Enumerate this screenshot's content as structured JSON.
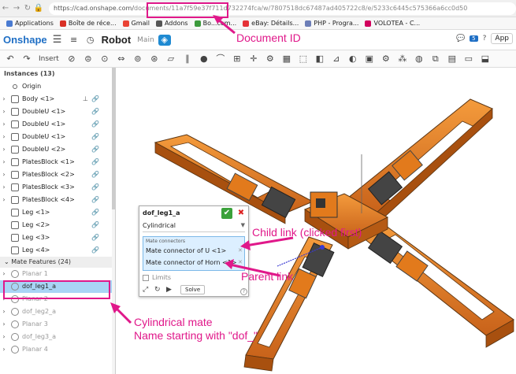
{
  "browser": {
    "url_host": "https://cad.onshape.com/",
    "url_path": "documents/11a7f59e37f711d732274fca/w/7807518dc67487ad405722c8/e/5233c6445c575366a6cc0d50",
    "bookmarks": [
      {
        "label": "Applications",
        "color": "#4a7bd1"
      },
      {
        "label": "Boîte de réce...",
        "color": "#d93025"
      },
      {
        "label": "Gmail",
        "color": "#ea4335"
      },
      {
        "label": "Addons",
        "color": "#555555"
      },
      {
        "label": "Bo...com...",
        "color": "#3c9a3c"
      },
      {
        "label": "eBay: Détails...",
        "color": "#e53238"
      },
      {
        "label": "PHP - Progra...",
        "color": "#6c7eb7"
      },
      {
        "label": "VOLOTEA - C...",
        "color": "#d1005d"
      }
    ]
  },
  "app": {
    "logo": "Onshape",
    "doc_name": "Robot",
    "branch": "Main",
    "notif_count": "5",
    "user_btn": "App"
  },
  "toolbar": {
    "insert_label": "Insert"
  },
  "panel": {
    "instances_header": "Instances (13)",
    "origin": "Origin",
    "instances": [
      {
        "label": "Body <1>",
        "fixed": true
      },
      {
        "label": "DoubleU <1>"
      },
      {
        "label": "DoubleU <1>"
      },
      {
        "label": "DoubleU <1>"
      },
      {
        "label": "DoubleU <2>"
      },
      {
        "label": "PlatesBlock <1>"
      },
      {
        "label": "PlatesBlock <2>"
      },
      {
        "label": "PlatesBlock <3>"
      },
      {
        "label": "PlatesBlock <4>"
      },
      {
        "label": "Leg <1>"
      },
      {
        "label": "Leg <2>"
      },
      {
        "label": "Leg <3>"
      },
      {
        "label": "Leg <4>"
      }
    ],
    "mate_header": "Mate Features (24)",
    "mates": [
      {
        "label": "Planar 1",
        "state": "gray"
      },
      {
        "label": "dof_leg1_a",
        "state": "selected"
      },
      {
        "label": "Planar 2",
        "state": "gray"
      },
      {
        "label": "dof_leg2_a",
        "state": "gray"
      },
      {
        "label": "Planar 3",
        "state": "gray"
      },
      {
        "label": "dof_leg3_a",
        "state": "gray"
      },
      {
        "label": "Planar 4",
        "state": "gray"
      }
    ]
  },
  "dialog": {
    "title": "dof_leg1_a",
    "mate_type": "Cylindrical",
    "connectors_header": "Mate connectors",
    "connector_1": "Mate connector of U <1>",
    "connector_2": "Mate connector of Horn <1>",
    "limits_label": "Limits",
    "solve_label": "Solve"
  },
  "annotations": {
    "document_id": "Document ID",
    "child_link": "Child link (clicked first)",
    "parent_link": "Parent link",
    "mate_line1": "Cylindrical mate",
    "mate_line2": "Name starting with \"dof_\""
  },
  "colors": {
    "accent": "#e0188a",
    "part_orange": "#e8821e",
    "onshape_blue": "#1f6fc5"
  }
}
